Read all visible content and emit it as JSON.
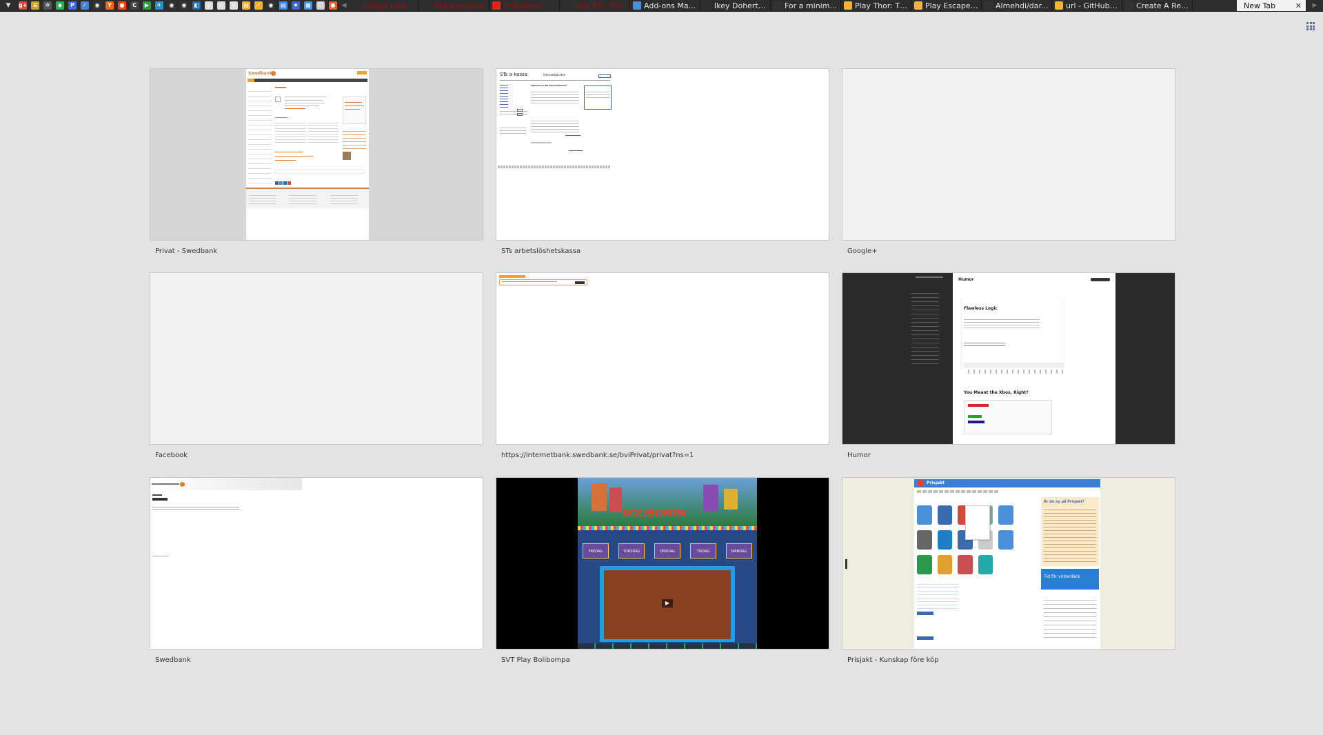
{
  "tabstrip": {
    "pinned_icons": [
      {
        "icon": "google-plus-icon",
        "color": "#d34836",
        "glyph": "g+"
      },
      {
        "icon": "document-icon",
        "color": "#c9a227",
        "glyph": "≡"
      },
      {
        "icon": "settings-icon",
        "color": "#555555",
        "glyph": "✲"
      },
      {
        "icon": "feedly-icon",
        "color": "#2bb24c",
        "glyph": "◆"
      },
      {
        "icon": "pocket-icon",
        "color": "#3b6fd6",
        "glyph": "P"
      },
      {
        "icon": "app-icon",
        "color": "#4a7fd4",
        "glyph": "✓"
      },
      {
        "icon": "github-icon",
        "color": "#333333",
        "glyph": "◉"
      },
      {
        "icon": "hacker-news-icon",
        "color": "#ff6600",
        "glyph": "Y"
      },
      {
        "icon": "reddit-icon",
        "color": "#ff4500",
        "glyph": "●"
      },
      {
        "icon": "c-icon",
        "color": "#444444",
        "glyph": "C"
      },
      {
        "icon": "play-icon",
        "color": "#2e9e3e",
        "glyph": "▶"
      },
      {
        "icon": "bird-icon",
        "color": "#2a8ec4",
        "glyph": "✈"
      },
      {
        "icon": "github-icon",
        "color": "#333333",
        "glyph": "◉"
      },
      {
        "icon": "github-icon",
        "color": "#333333",
        "glyph": "◉"
      },
      {
        "icon": "dropbox-icon",
        "color": "#1f6fb2",
        "glyph": "◧"
      },
      {
        "icon": "page-icon",
        "color": "#dddddd",
        "glyph": "▫"
      },
      {
        "icon": "page-icon",
        "color": "#dddddd",
        "glyph": "▫"
      },
      {
        "icon": "page-icon",
        "color": "#dddddd",
        "glyph": "▫"
      },
      {
        "icon": "paper-icon",
        "color": "#f2b233",
        "glyph": "▤"
      },
      {
        "icon": "check-icon",
        "color": "#f2b233",
        "glyph": "✓"
      },
      {
        "icon": "github-icon",
        "color": "#333333",
        "glyph": "◉"
      },
      {
        "icon": "google-docs-icon",
        "color": "#4285f4",
        "glyph": "▤"
      },
      {
        "icon": "star-icon",
        "color": "#3c6ad4",
        "glyph": "★"
      },
      {
        "icon": "video-icon",
        "color": "#4a90d9",
        "glyph": "▦"
      },
      {
        "icon": "alien-icon",
        "color": "#cccccc",
        "glyph": "☺"
      },
      {
        "icon": "bolibompa-icon",
        "color": "#f15a24",
        "glyph": "●"
      }
    ],
    "tabs": [
      {
        "title": "Lediga jobb",
        "fav_color": "#2d2d2d",
        "dim": true
      },
      {
        "title": "Väderseendet",
        "fav_color": "#2d2d2d",
        "dim": true
      },
      {
        "title": "Prehistoric",
        "fav_color": "#e62117",
        "dim": true
      },
      {
        "title": "Play IPK: The",
        "fav_color": "#2d2d2d",
        "dim": true
      },
      {
        "title": "Add-ons Ma...",
        "fav_color": "#4a90d9",
        "dim": false
      },
      {
        "title": "Ikey Doherty...",
        "fav_color": "#2d2d2d",
        "dim": false
      },
      {
        "title": "For a minim...",
        "fav_color": "#333333",
        "dim": false
      },
      {
        "title": "Play Thor: Th...",
        "fav_color": "#f2b233",
        "dim": false
      },
      {
        "title": "Play Escape ...",
        "fav_color": "#f2b233",
        "dim": false
      },
      {
        "title": "Almehdi/dar...",
        "fav_color": "#333333",
        "dim": false
      },
      {
        "title": "url - GitHub ...",
        "fav_color": "#f2b233",
        "dim": false
      },
      {
        "title": "Create A Re...",
        "fav_color": "#333333",
        "dim": false
      }
    ],
    "active_tab": {
      "title": "New Tab",
      "close": "✕"
    }
  },
  "most_visited": [
    {
      "title": "Privat - Swedbank",
      "kind": "swedbank"
    },
    {
      "title": "STs arbetslöshetskassa",
      "kind": "akassa"
    },
    {
      "title": "Google+",
      "kind": "blank"
    },
    {
      "title": "Facebook",
      "kind": "blank"
    },
    {
      "title": "https://internetbank.swedbank.se/bviPrivat/privat?ns=1",
      "kind": "swedbank-login"
    },
    {
      "title": "Humor",
      "kind": "humor"
    },
    {
      "title": "Swedbank",
      "kind": "swedbank-min"
    },
    {
      "title": "SVT Play Bolibompa",
      "kind": "bolibompa"
    },
    {
      "title": "Prisjakt - Kunskap före köp",
      "kind": "prisjakt"
    }
  ],
  "thumb_text": {
    "akassa_logo": "STs a-kassa",
    "akassa_heading": "Internettjänsten",
    "akassa_welcome": "Välkommen till Internetkassan",
    "humor_heading": "Humor",
    "humor_post1": "Flawless Logic",
    "humor_post2": "You Meant the Xbox, Right?",
    "swedbank_logo": "Swedbank",
    "prisjakt_logo": "Prisjakt",
    "prisjakt_sidebar": "Är du ny på Prisjakt?",
    "prisjakt_tire": "Tid för vinterdäck",
    "bolibompa_logo": "BOLIBOMPA",
    "bolibompa_days": [
      "FREDAG",
      "TORSDAG",
      "ONSDAG",
      "TISDAG",
      "MÅNDAG"
    ]
  }
}
